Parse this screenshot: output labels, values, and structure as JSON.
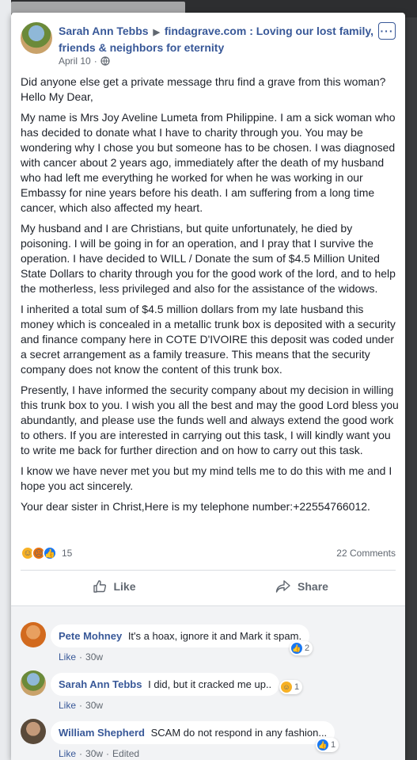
{
  "post": {
    "author": "Sarah Ann Tebbs",
    "separator": "▶",
    "group": "findagrave.com : Loving our lost family, friends & neighbors for eternity",
    "date": "April 10",
    "dot": "·",
    "paragraphs": [
      "Did anyone else get a private message thru find a grave from this woman? Hello My Dear,",
      "My name is Mrs Joy Aveline Lumeta from Philippine. I am a sick woman who has decided to donate what I have to charity through you. You may be wondering why I chose you but someone has to be chosen. I was diagnosed with cancer about 2 years ago, immediately after the death of my husband who had left me everything he worked for when he was working in our Embassy for nine years before his death. I am suffering from a long time cancer, which also affected my heart.",
      "My husband and I are Christians, but quite unfortunately, he died by poisoning. I will be going in for an operation, and I pray that I survive the operation. I have decided to WILL / Donate the sum of $4.5 Million United State Dollars to charity through you for the good work of the lord, and to help the motherless, less privileged and also for the assistance of the widows.",
      "I inherited a total sum of $4.5 million dollars from my late husband this money which is concealed in a metallic trunk box is deposited with a security and finance company here in COTE D'IVOIRE this deposit was coded under a secret arrangement as a family treasure. This means that the security company does not know the content of this trunk box.",
      "Presently, I have informed the security company about my decision in willing this trunk box to you. I wish you all the best and may the good Lord bless you abundantly, and please use the funds well and always extend the good work to others. If you are interested in carrying out this task, I will kindly want you to write me back for further direction and on how to carry out this task.",
      "I know we have never met you but my mind tells me to do this with me and I hope you act sincerely.",
      "Your dear sister in Christ,Here is my telephone number:+22554766012."
    ],
    "reaction_count": "15",
    "comments_count": "22 Comments",
    "like_label": "Like",
    "share_label": "Share",
    "more_label": "···"
  },
  "comments": [
    {
      "name": "Pete Mohney",
      "text": "It's a hoax, ignore it and Mark it spam.",
      "like": "Like",
      "time": "30w",
      "reaction": "like",
      "reaction_count": "2"
    },
    {
      "name": "Sarah Ann Tebbs",
      "text": "I did, but it cracked me up..",
      "like": "Like",
      "time": "30w",
      "reaction": "haha",
      "reaction_count": "1"
    },
    {
      "name": "William Shepherd",
      "text": "SCAM do not respond in any fashion...",
      "like": "Like",
      "time": "30w",
      "edited": "Edited",
      "reaction": "like",
      "reaction_count": "1"
    }
  ],
  "colors": {
    "link": "#385898",
    "text": "#1d2129",
    "muted": "#606770",
    "like_blue": "#1877f2"
  }
}
